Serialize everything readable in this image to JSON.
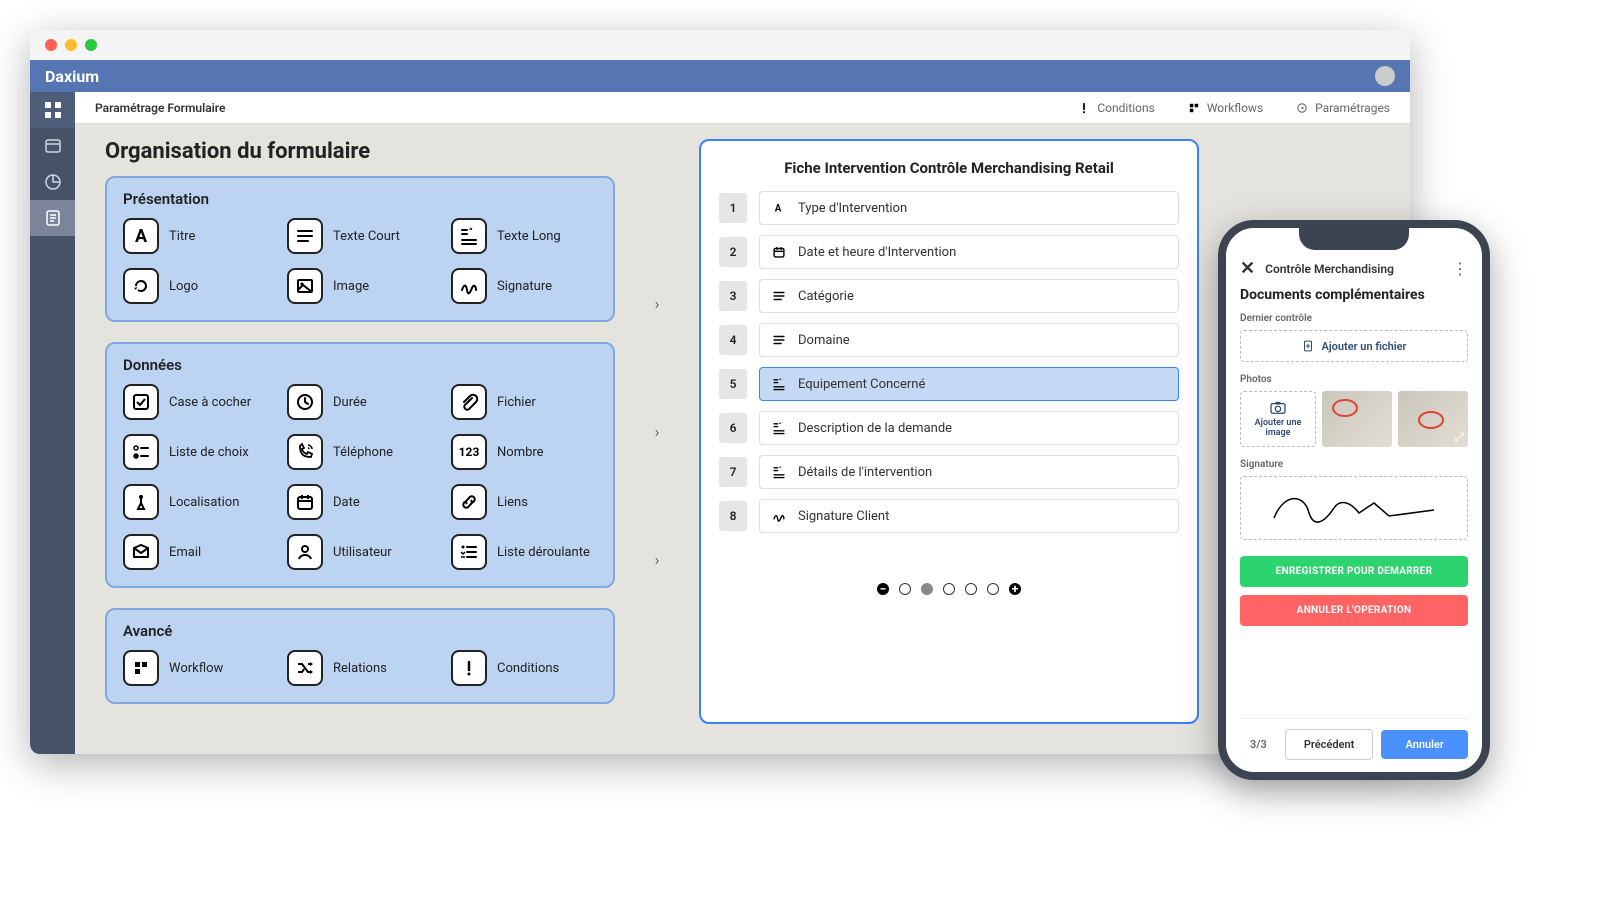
{
  "window": {
    "brand": "Daxium"
  },
  "subheader": {
    "title": "Paramétrage Formulaire",
    "right": [
      {
        "label": "Conditions"
      },
      {
        "label": "Workflows"
      },
      {
        "label": "Paramétrages"
      }
    ]
  },
  "page": {
    "title": "Organisation du formulaire"
  },
  "panels": {
    "presentation": {
      "title": "Présentation",
      "items": [
        {
          "label": "Titre",
          "icon": "A"
        },
        {
          "label": "Texte Court",
          "icon": "lines"
        },
        {
          "label": "Texte Long",
          "icon": "quote"
        },
        {
          "label": "Logo",
          "icon": "refresh"
        },
        {
          "label": "Image",
          "icon": "image"
        },
        {
          "label": "Signature",
          "icon": "sig"
        }
      ]
    },
    "data": {
      "title": "Données",
      "items": [
        {
          "label": "Case à cocher",
          "icon": "check"
        },
        {
          "label": "Durée",
          "icon": "clock"
        },
        {
          "label": "Fichier",
          "icon": "clip"
        },
        {
          "label": "Liste de choix",
          "icon": "listcheck"
        },
        {
          "label": "Téléphone",
          "icon": "phone"
        },
        {
          "label": "Nombre",
          "icon": "123"
        },
        {
          "label": "Localisation",
          "icon": "pin"
        },
        {
          "label": "Date",
          "icon": "calendar"
        },
        {
          "label": "Liens",
          "icon": "link"
        },
        {
          "label": "Email",
          "icon": "mail"
        },
        {
          "label": "Utilisateur",
          "icon": "user"
        },
        {
          "label": "Liste déroulante",
          "icon": "dropdown"
        }
      ]
    },
    "advanced": {
      "title": "Avancé",
      "items": [
        {
          "label": "Workflow",
          "icon": "workflow"
        },
        {
          "label": "Relations",
          "icon": "shuffle"
        },
        {
          "label": "Conditions",
          "icon": "exclaim"
        }
      ]
    }
  },
  "preview": {
    "title": "Fiche Intervention Contrôle Merchandising Retail",
    "rows": [
      {
        "n": "1",
        "label": "Type d'Intervention",
        "icon": "A"
      },
      {
        "n": "2",
        "label": "Date et heure d'Intervention",
        "icon": "calendar"
      },
      {
        "n": "3",
        "label": "Catégorie",
        "icon": "lines"
      },
      {
        "n": "4",
        "label": "Domaine",
        "icon": "lines"
      },
      {
        "n": "5",
        "label": "Equipement Concerné",
        "icon": "quote",
        "selected": true
      },
      {
        "n": "6",
        "label": "Description de la demande",
        "icon": "quote"
      },
      {
        "n": "7",
        "label": "Détails de l'intervention",
        "icon": "quote"
      },
      {
        "n": "8",
        "label": "Signature Client",
        "icon": "sig"
      }
    ]
  },
  "phone": {
    "title": "Contrôle Merchandising",
    "heading": "Documents complémentaires",
    "section_last_check": "Dernier contrôle",
    "add_file": "Ajouter un fichier",
    "section_photos": "Photos",
    "add_image": "Ajouter une image",
    "section_signature": "Signature",
    "btn_save": "ENREGISTRER POUR DEMARRER",
    "btn_cancel_op": "ANNULER L'OPERATION",
    "step": "3/3",
    "btn_prev": "Précédent",
    "btn_cancel": "Annuler"
  }
}
